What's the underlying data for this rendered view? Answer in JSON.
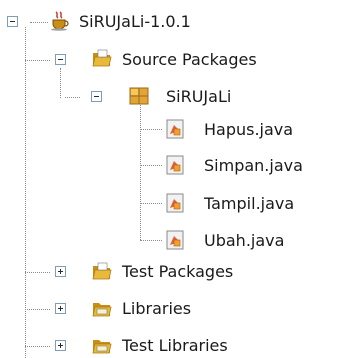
{
  "tree": {
    "project": {
      "label": "SiRUJaLi-1.0.1",
      "icon": "coffee-cup-project-icon"
    },
    "source_packages": {
      "label": "Source Packages",
      "icon": "source-folder-icon"
    },
    "package": {
      "label": "SiRUJaLi",
      "icon": "package-icon"
    },
    "files": [
      {
        "label": "Hapus.java",
        "icon": "java-form-icon"
      },
      {
        "label": "Simpan.java",
        "icon": "java-form-icon"
      },
      {
        "label": "Tampil.java",
        "icon": "java-form-icon"
      },
      {
        "label": "Ubah.java",
        "icon": "java-form-icon"
      }
    ],
    "test_packages": {
      "label": "Test Packages",
      "icon": "test-folder-icon"
    },
    "libraries": {
      "label": "Libraries",
      "icon": "libraries-folder-icon"
    },
    "test_libraries": {
      "label": "Test Libraries",
      "icon": "test-libraries-folder-icon"
    }
  },
  "colors": {
    "folder": "#e8b93a",
    "folder_dark": "#c98f12",
    "package": "#e0a53a",
    "file_page": "#f2f2f2",
    "file_accent": "#d9481f",
    "tree_line": "#8a8a8a",
    "expander_border": "#7f9db9"
  }
}
